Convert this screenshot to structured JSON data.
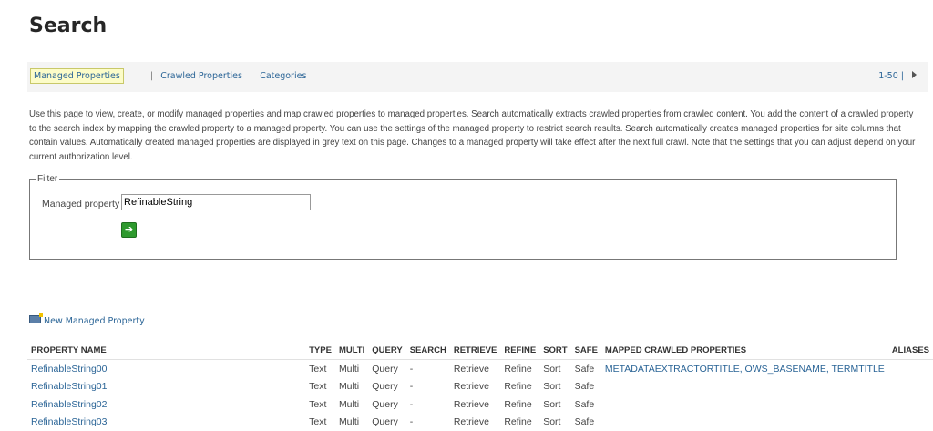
{
  "page": {
    "title": "Search"
  },
  "toolbar": {
    "tabs": [
      "Managed Properties",
      "Crawled Properties",
      "Categories"
    ],
    "paging": "1-50 |",
    "separator": "|"
  },
  "description": "Use this page to view, create, or modify managed properties and map crawled properties to managed properties. Search automatically extracts crawled properties from crawled content. You add the content of a crawled property to the search index by mapping the crawled property to a managed property. You can use the settings of the managed property to restrict search results. Search automatically creates managed properties for site columns that contain values. Automatically created managed properties are displayed in grey text on this page. Changes to a managed property will take effect after the next full crawl. Note that the settings that you can adjust depend on your current authorization level.",
  "filter": {
    "legend": "Filter",
    "label": "Managed property",
    "value": "RefinableString",
    "go_icon": "arrow-right-icon"
  },
  "actions": {
    "new_property": "New Managed Property"
  },
  "table": {
    "headers": [
      "PROPERTY NAME",
      "TYPE",
      "MULTI",
      "QUERY",
      "SEARCH",
      "RETRIEVE",
      "REFINE",
      "SORT",
      "SAFE",
      "MAPPED CRAWLED PROPERTIES",
      "ALIASES"
    ],
    "rows": [
      [
        "RefinableString00",
        "Text",
        "Multi",
        "Query",
        "-",
        "Retrieve",
        "Refine",
        "Sort",
        "Safe",
        "METADATAEXTRACTORTITLE, OWS_BASENAME, TERMTITLE",
        ""
      ],
      [
        "RefinableString01",
        "Text",
        "Multi",
        "Query",
        "-",
        "Retrieve",
        "Refine",
        "Sort",
        "Safe",
        "",
        ""
      ],
      [
        "RefinableString02",
        "Text",
        "Multi",
        "Query",
        "-",
        "Retrieve",
        "Refine",
        "Sort",
        "Safe",
        "",
        ""
      ],
      [
        "RefinableString03",
        "Text",
        "Multi",
        "Query",
        "-",
        "Retrieve",
        "Refine",
        "Sort",
        "Safe",
        "",
        ""
      ]
    ]
  }
}
